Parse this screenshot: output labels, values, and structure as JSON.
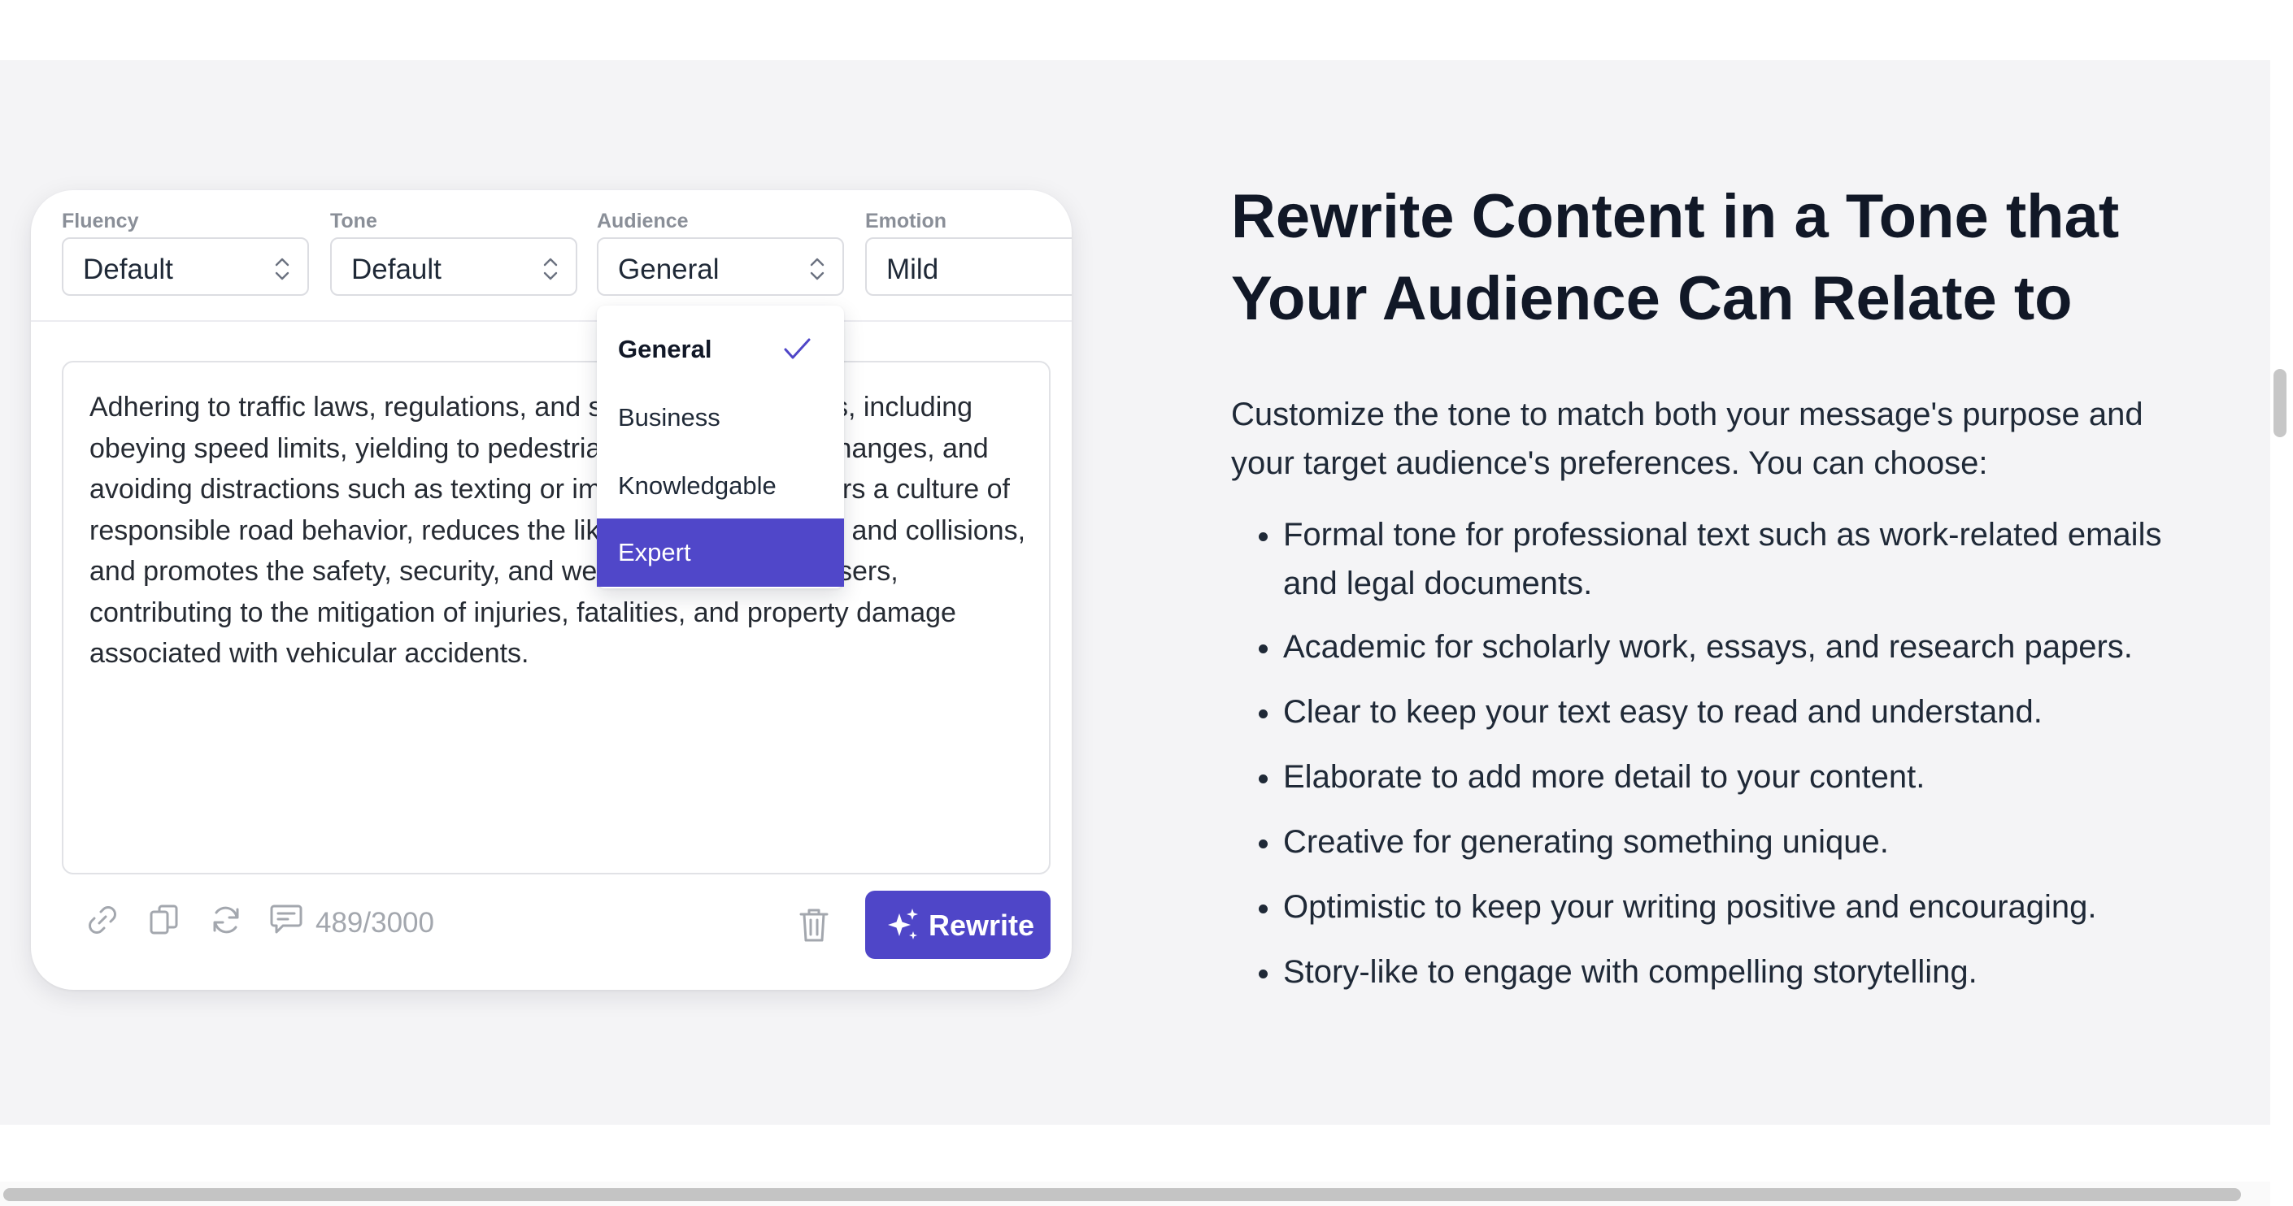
{
  "card": {
    "selectors": [
      {
        "label": "Fluency",
        "value": "Default"
      },
      {
        "label": "Tone",
        "value": "Default"
      },
      {
        "label": "Audience",
        "value": "General"
      },
      {
        "label": "Emotion",
        "value": "Mild"
      }
    ],
    "input_text": "Adhering to traffic laws, regulations, and safe driving practices, including obeying speed limits, yielding to pedestrians, signaling lane changes, and avoiding distractions such as texting or impaired driving, fosters a culture of responsible road behavior, reduces the likelihood of accidents and collisions, and promotes the safety, security, and well-being of all road users, contributing to the mitigation of injuries, fatalities, and property damage associated with vehicular accidents.",
    "toolbar": {
      "icons": [
        "link-icon",
        "copy-icon",
        "refresh-icon",
        "feedback-icon",
        "trash-icon",
        "sparkle-icon"
      ],
      "counter": "489/3000",
      "rewrite_label": "Rewrite"
    },
    "audience_dropdown": {
      "options": [
        "General",
        "Business",
        "Knowledgable",
        "Expert"
      ],
      "selected": "General",
      "highlighted": "Expert"
    }
  },
  "copy": {
    "heading": "Rewrite Content in a Tone that Your Audience Can Relate to",
    "intro": "Customize the tone to match both your message's purpose and your target audience's preferences. You can choose:",
    "bullets": [
      "Formal tone for professional text such as work-related emails and legal documents.",
      "Academic for scholarly work, essays, and research papers.",
      "Clear to keep your text easy to read and understand.",
      "Elaborate to add more detail to your content.",
      "Creative for generating something unique.",
      "Optimistic to keep your writing positive and encouraging.",
      "Story-like to engage with compelling storytelling."
    ]
  },
  "colors": {
    "accent": "#4f46c8",
    "section_background": "#f4f4f6",
    "text": "#111827",
    "muted": "#a3a7ae"
  }
}
